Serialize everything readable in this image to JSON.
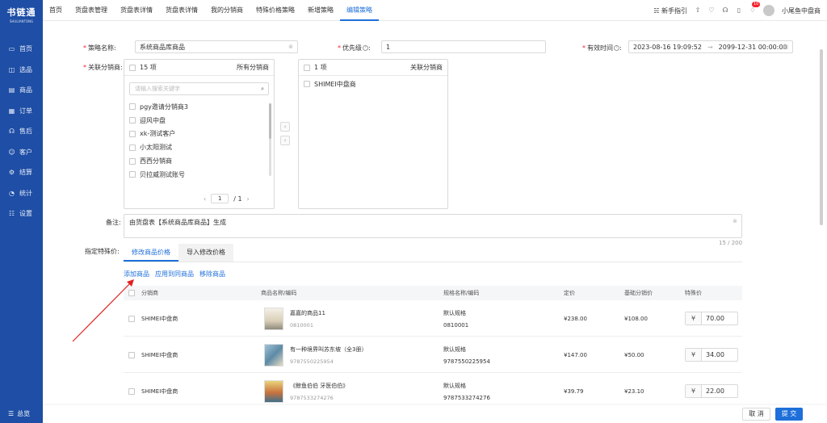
{
  "brand": {
    "name": "书链通",
    "tagline": "SHULIANTONG"
  },
  "sidebar": {
    "items": [
      {
        "label": "首页",
        "icon": "monitor-icon"
      },
      {
        "label": "选品",
        "icon": "select-icon"
      },
      {
        "label": "商品",
        "icon": "goods-icon"
      },
      {
        "label": "订单",
        "icon": "order-icon"
      },
      {
        "label": "售后",
        "icon": "aftersale-icon"
      },
      {
        "label": "客户",
        "icon": "customer-icon"
      },
      {
        "label": "结算",
        "icon": "settle-icon"
      },
      {
        "label": "统计",
        "icon": "stats-icon"
      },
      {
        "label": "设置",
        "icon": "settings-icon"
      }
    ],
    "bottom_label": "总览"
  },
  "tabs": [
    "首页",
    "货盘表管理",
    "货盘表详情",
    "货盘表详情",
    "我的分销商",
    "特殊价格策略",
    "新增策略",
    "编辑策略"
  ],
  "active_tab": 7,
  "topbar": {
    "guide": "新手指引",
    "badge": "10",
    "username": "小尾鱼中盘商"
  },
  "form": {
    "strategy_name_label": "策略名称:",
    "strategy_name_value": "系统商品库商品",
    "priority_label": "优先级",
    "priority_value": "1",
    "valid_time_label": "有效时间",
    "valid_start": "2023-08-16 19:09:52",
    "valid_end": "2099-12-31 00:00:00",
    "related_label": "关联分销商:",
    "left_panel": {
      "count": "15 项",
      "title": "所有分销商",
      "search_placeholder": "请输入搜索关键字",
      "items": [
        "pgy邀请分销商3",
        "迎风中盘",
        "xk-测试客户",
        "小太阳测试",
        "西西分销商",
        "贝拉威测试账号"
      ],
      "page": "1",
      "total_pages": "/ 1"
    },
    "right_panel": {
      "count": "1 项",
      "title": "关联分销商",
      "items": [
        "SHIMEI中盘商"
      ]
    },
    "remark_label": "备注:",
    "remark_value": "由货盘表【系统商品库商品】生成",
    "remark_count": "15 / 200",
    "special_price_label": "指定特殊价:",
    "subtabs": [
      "修改商品价格",
      "导入修改价格"
    ],
    "actions": [
      "添加商品",
      "应用到同商品",
      "移除商品"
    ]
  },
  "table": {
    "headers": [
      "分销商",
      "商品名称/编码",
      "规格名称/编码",
      "定价",
      "基础分销价",
      "特殊价"
    ],
    "rows": [
      {
        "dist": "SHIMEI中盘商",
        "name": "嘉嘉的商品11",
        "code": "0810001",
        "spec": "默认规格",
        "spec_code": "0810001",
        "price": "¥238.00",
        "base": "¥108.00",
        "special": "70.00"
      },
      {
        "dist": "SHIMEI中盘商",
        "name": "有一种境界叫苏东坡（全3册）",
        "code": "9787550225954",
        "spec": "默认规格",
        "spec_code": "9787550225954",
        "price": "¥147.00",
        "base": "¥50.00",
        "special": "34.00"
      },
      {
        "dist": "SHIMEI中盘商",
        "name": "《鲸鱼伯伯 牙医伯伯》",
        "code": "9787533274276",
        "spec": "默认规格",
        "spec_code": "9787533274276",
        "price": "¥39.79",
        "base": "¥23.10",
        "special": "22.00"
      }
    ]
  },
  "footer": {
    "cancel": "取 消",
    "submit": "提 交"
  },
  "colors": {
    "sidebar": "#1e4ea5",
    "accent": "#1e6fd9",
    "annotation_arrow": "#e02020"
  }
}
